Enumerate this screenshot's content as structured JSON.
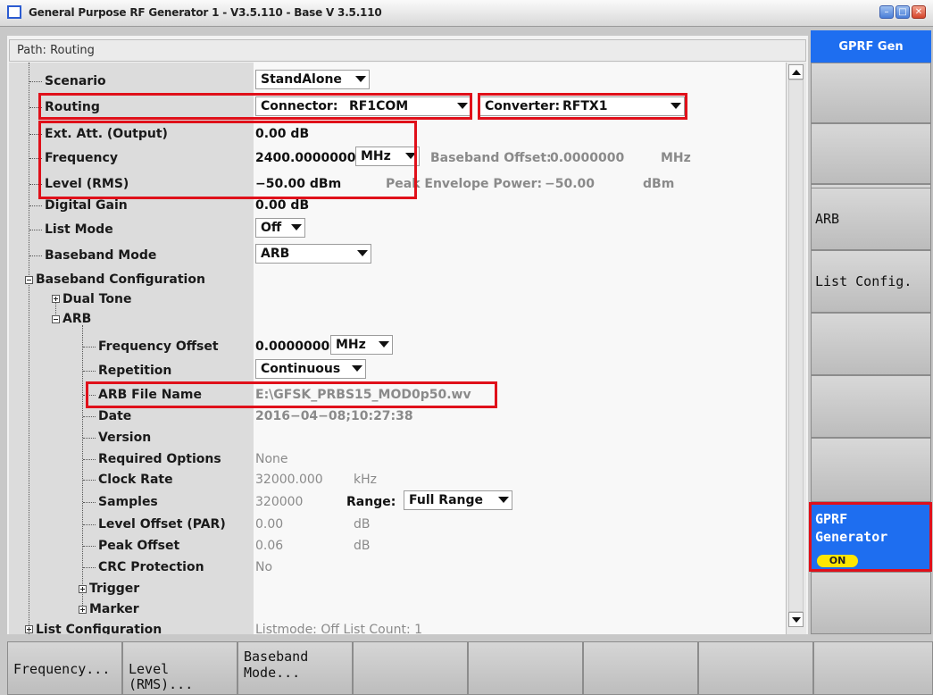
{
  "window": {
    "title": "General Purpose RF Generator 1 - V3.5.110 - Base V 3.5.110",
    "buttons": [
      "min",
      "max",
      "close"
    ]
  },
  "path": "Path: Routing",
  "side_header": "GPRF Gen",
  "tree": {
    "scenario": "Scenario",
    "routing": "Routing",
    "ext_att": "Ext. Att. (Output)",
    "frequency": "Frequency",
    "level": "Level (RMS)",
    "digital_gain": "Digital Gain",
    "list_mode": "List Mode",
    "baseband_mode": "Baseband Mode",
    "baseband_config": "Baseband Configuration",
    "dual_tone": "Dual Tone",
    "arb": "ARB",
    "freq_offset": "Frequency Offset",
    "repetition": "Repetition",
    "arb_file_name": "ARB File Name",
    "date": "Date",
    "version": "Version",
    "required_options": "Required Options",
    "clock_rate": "Clock Rate",
    "samples": "Samples",
    "level_offset": "Level Offset (PAR)",
    "peak_offset": "Peak Offset",
    "crc": "CRC Protection",
    "trigger": "Trigger",
    "marker": "Marker",
    "list_config": "List Configuration"
  },
  "values": {
    "scenario": "StandAlone",
    "connector_label": "Connector:",
    "connector": "RF1COM",
    "converter_label": "Converter:",
    "converter": "RFTX1",
    "ext_att": "0.00 dB",
    "frequency": "2400.0000000",
    "frequency_unit": "MHz",
    "baseband_offset_label": "Baseband Offset:",
    "baseband_offset": "0.0000000",
    "baseband_offset_unit": "MHz",
    "level": "−50.00 dBm",
    "pep_label": "Peak Envelope Power:",
    "pep": "−50.00",
    "pep_unit": "dBm",
    "digital_gain": "0.00 dB",
    "list_mode": "Off",
    "baseband_mode": "ARB",
    "freq_offset": "0.0000000",
    "freq_offset_unit": "MHz",
    "repetition": "Continuous",
    "arb_file_name": "E:\\GFSK_PRBS15_MOD0p50.wv",
    "date": "2016−04−08;10:27:38",
    "required_options": "None",
    "clock_rate": "32000.000",
    "clock_rate_unit": "kHz",
    "samples": "320000",
    "range_label": "Range:",
    "range": "Full Range",
    "level_offset": "0.00",
    "level_offset_unit": "dB",
    "peak_offset": "0.06",
    "peak_offset_unit": "dB",
    "crc": "No",
    "list_config_partial": "Listmode: Off      List Count: 1"
  },
  "right_buttons": {
    "arb": "ARB",
    "list_config": "List Config.",
    "gprf_line1": "GPRF",
    "gprf_line2": "Generator",
    "gprf_state": "ON"
  },
  "softkeys": {
    "frequency": "Frequency...",
    "level": "Level (RMS)...",
    "baseband_line1": "Baseband",
    "baseband_line2": "Mode..."
  },
  "colors": {
    "highlight_red": "#e0101a",
    "accent_blue": "#1e6ef0",
    "on_yellow": "#ffe600"
  }
}
